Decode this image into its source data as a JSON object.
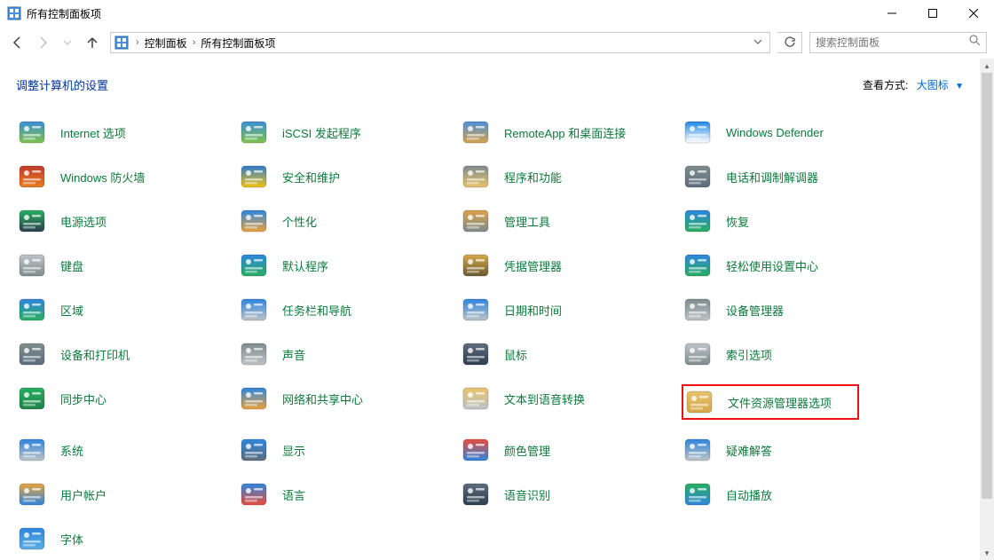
{
  "window": {
    "title": "所有控制面板项"
  },
  "breadcrumb": {
    "root": "控制面板",
    "current": "所有控制面板项"
  },
  "search": {
    "placeholder": "搜索控制面板"
  },
  "header": {
    "heading": "调整计算机的设置",
    "viewby_label": "查看方式:",
    "viewby_value": "大图标"
  },
  "items": [
    {
      "label": "Internet 选项",
      "icon": "internet-options-icon"
    },
    {
      "label": "iSCSI 发起程序",
      "icon": "iscsi-icon"
    },
    {
      "label": "RemoteApp 和桌面连接",
      "icon": "remoteapp-icon"
    },
    {
      "label": "Windows Defender",
      "icon": "defender-icon"
    },
    {
      "label": "Windows 防火墙",
      "icon": "firewall-icon"
    },
    {
      "label": "安全和维护",
      "icon": "security-maintenance-icon"
    },
    {
      "label": "程序和功能",
      "icon": "programs-features-icon"
    },
    {
      "label": "电话和调制解调器",
      "icon": "phone-modem-icon"
    },
    {
      "label": "电源选项",
      "icon": "power-options-icon"
    },
    {
      "label": "个性化",
      "icon": "personalization-icon"
    },
    {
      "label": "管理工具",
      "icon": "admin-tools-icon"
    },
    {
      "label": "恢复",
      "icon": "recovery-icon"
    },
    {
      "label": "键盘",
      "icon": "keyboard-icon"
    },
    {
      "label": "默认程序",
      "icon": "default-programs-icon"
    },
    {
      "label": "凭据管理器",
      "icon": "credential-manager-icon"
    },
    {
      "label": "轻松使用设置中心",
      "icon": "ease-of-access-icon"
    },
    {
      "label": "区域",
      "icon": "region-icon"
    },
    {
      "label": "任务栏和导航",
      "icon": "taskbar-nav-icon"
    },
    {
      "label": "日期和时间",
      "icon": "date-time-icon"
    },
    {
      "label": "设备管理器",
      "icon": "device-manager-icon"
    },
    {
      "label": "设备和打印机",
      "icon": "devices-printers-icon"
    },
    {
      "label": "声音",
      "icon": "sound-icon"
    },
    {
      "label": "鼠标",
      "icon": "mouse-icon"
    },
    {
      "label": "索引选项",
      "icon": "indexing-options-icon"
    },
    {
      "label": "同步中心",
      "icon": "sync-center-icon"
    },
    {
      "label": "网络和共享中心",
      "icon": "network-sharing-icon"
    },
    {
      "label": "文本到语音转换",
      "icon": "text-to-speech-icon"
    },
    {
      "label": "文件资源管理器选项",
      "icon": "file-explorer-options-icon",
      "highlight": true
    },
    {
      "label": "系统",
      "icon": "system-icon"
    },
    {
      "label": "显示",
      "icon": "display-icon"
    },
    {
      "label": "颜色管理",
      "icon": "color-management-icon"
    },
    {
      "label": "疑难解答",
      "icon": "troubleshooting-icon"
    },
    {
      "label": "用户帐户",
      "icon": "user-accounts-icon"
    },
    {
      "label": "语言",
      "icon": "language-icon"
    },
    {
      "label": "语音识别",
      "icon": "speech-recognition-icon"
    },
    {
      "label": "自动播放",
      "icon": "autoplay-icon"
    },
    {
      "label": "字体",
      "icon": "fonts-icon"
    }
  ],
  "icon_colors": {
    "internet-options-icon": [
      "#3b8fd6",
      "#7fc24a"
    ],
    "iscsi-icon": [
      "#3b8fd6",
      "#7fc24a"
    ],
    "remoteapp-icon": [
      "#4a90d9",
      "#d9a24a"
    ],
    "defender-icon": [
      "#1e88e5",
      "#ffffff"
    ],
    "firewall-icon": [
      "#c0392b",
      "#e67e22"
    ],
    "security-maintenance-icon": [
      "#2e7bcf",
      "#f1c40f"
    ],
    "programs-features-icon": [
      "#7f8c8d",
      "#e8c36a"
    ],
    "phone-modem-icon": [
      "#7f8c8d",
      "#5d6d7e"
    ],
    "power-options-icon": [
      "#27ae60",
      "#2c3e50"
    ],
    "personalization-icon": [
      "#2e86de",
      "#e8a33d"
    ],
    "admin-tools-icon": [
      "#d9a24a",
      "#7f8c8d"
    ],
    "recovery-icon": [
      "#2e86de",
      "#27ae60"
    ],
    "keyboard-icon": [
      "#bdc3c7",
      "#7f8c8d"
    ],
    "default-programs-icon": [
      "#2e86de",
      "#27ae60"
    ],
    "credential-manager-icon": [
      "#d4a84b",
      "#6b5b2f"
    ],
    "ease-of-access-icon": [
      "#2e86de",
      "#27ae60"
    ],
    "region-icon": [
      "#2e86de",
      "#27ae60"
    ],
    "taskbar-nav-icon": [
      "#2e86de",
      "#bdc3c7"
    ],
    "date-time-icon": [
      "#2e86de",
      "#bdc3c7"
    ],
    "device-manager-icon": [
      "#7f8c8d",
      "#bdc3c7"
    ],
    "devices-printers-icon": [
      "#7f8c8d",
      "#5d6d7e"
    ],
    "sound-icon": [
      "#7f8c8d",
      "#bdc3c7"
    ],
    "mouse-icon": [
      "#5d6d7e",
      "#2c3e50"
    ],
    "indexing-options-icon": [
      "#bdc3c7",
      "#7f8c8d"
    ],
    "sync-center-icon": [
      "#27ae60",
      "#1e8449"
    ],
    "network-sharing-icon": [
      "#2e86de",
      "#e8a33d"
    ],
    "text-to-speech-icon": [
      "#e8c36a",
      "#bdc3c7"
    ],
    "file-explorer-options-icon": [
      "#e8c36a",
      "#d4a84b"
    ],
    "system-icon": [
      "#2e86de",
      "#bdc3c7"
    ],
    "display-icon": [
      "#2e86de",
      "#5d6d7e"
    ],
    "color-management-icon": [
      "#e74c3c",
      "#2e86de"
    ],
    "troubleshooting-icon": [
      "#2e86de",
      "#bdc3c7"
    ],
    "user-accounts-icon": [
      "#e8a33d",
      "#2e86de"
    ],
    "language-icon": [
      "#2e86de",
      "#e74c3c"
    ],
    "speech-recognition-icon": [
      "#5d6d7e",
      "#2c3e50"
    ],
    "autoplay-icon": [
      "#27ae60",
      "#2e86de"
    ],
    "fonts-icon": [
      "#2e86de",
      "#5dade2"
    ]
  }
}
